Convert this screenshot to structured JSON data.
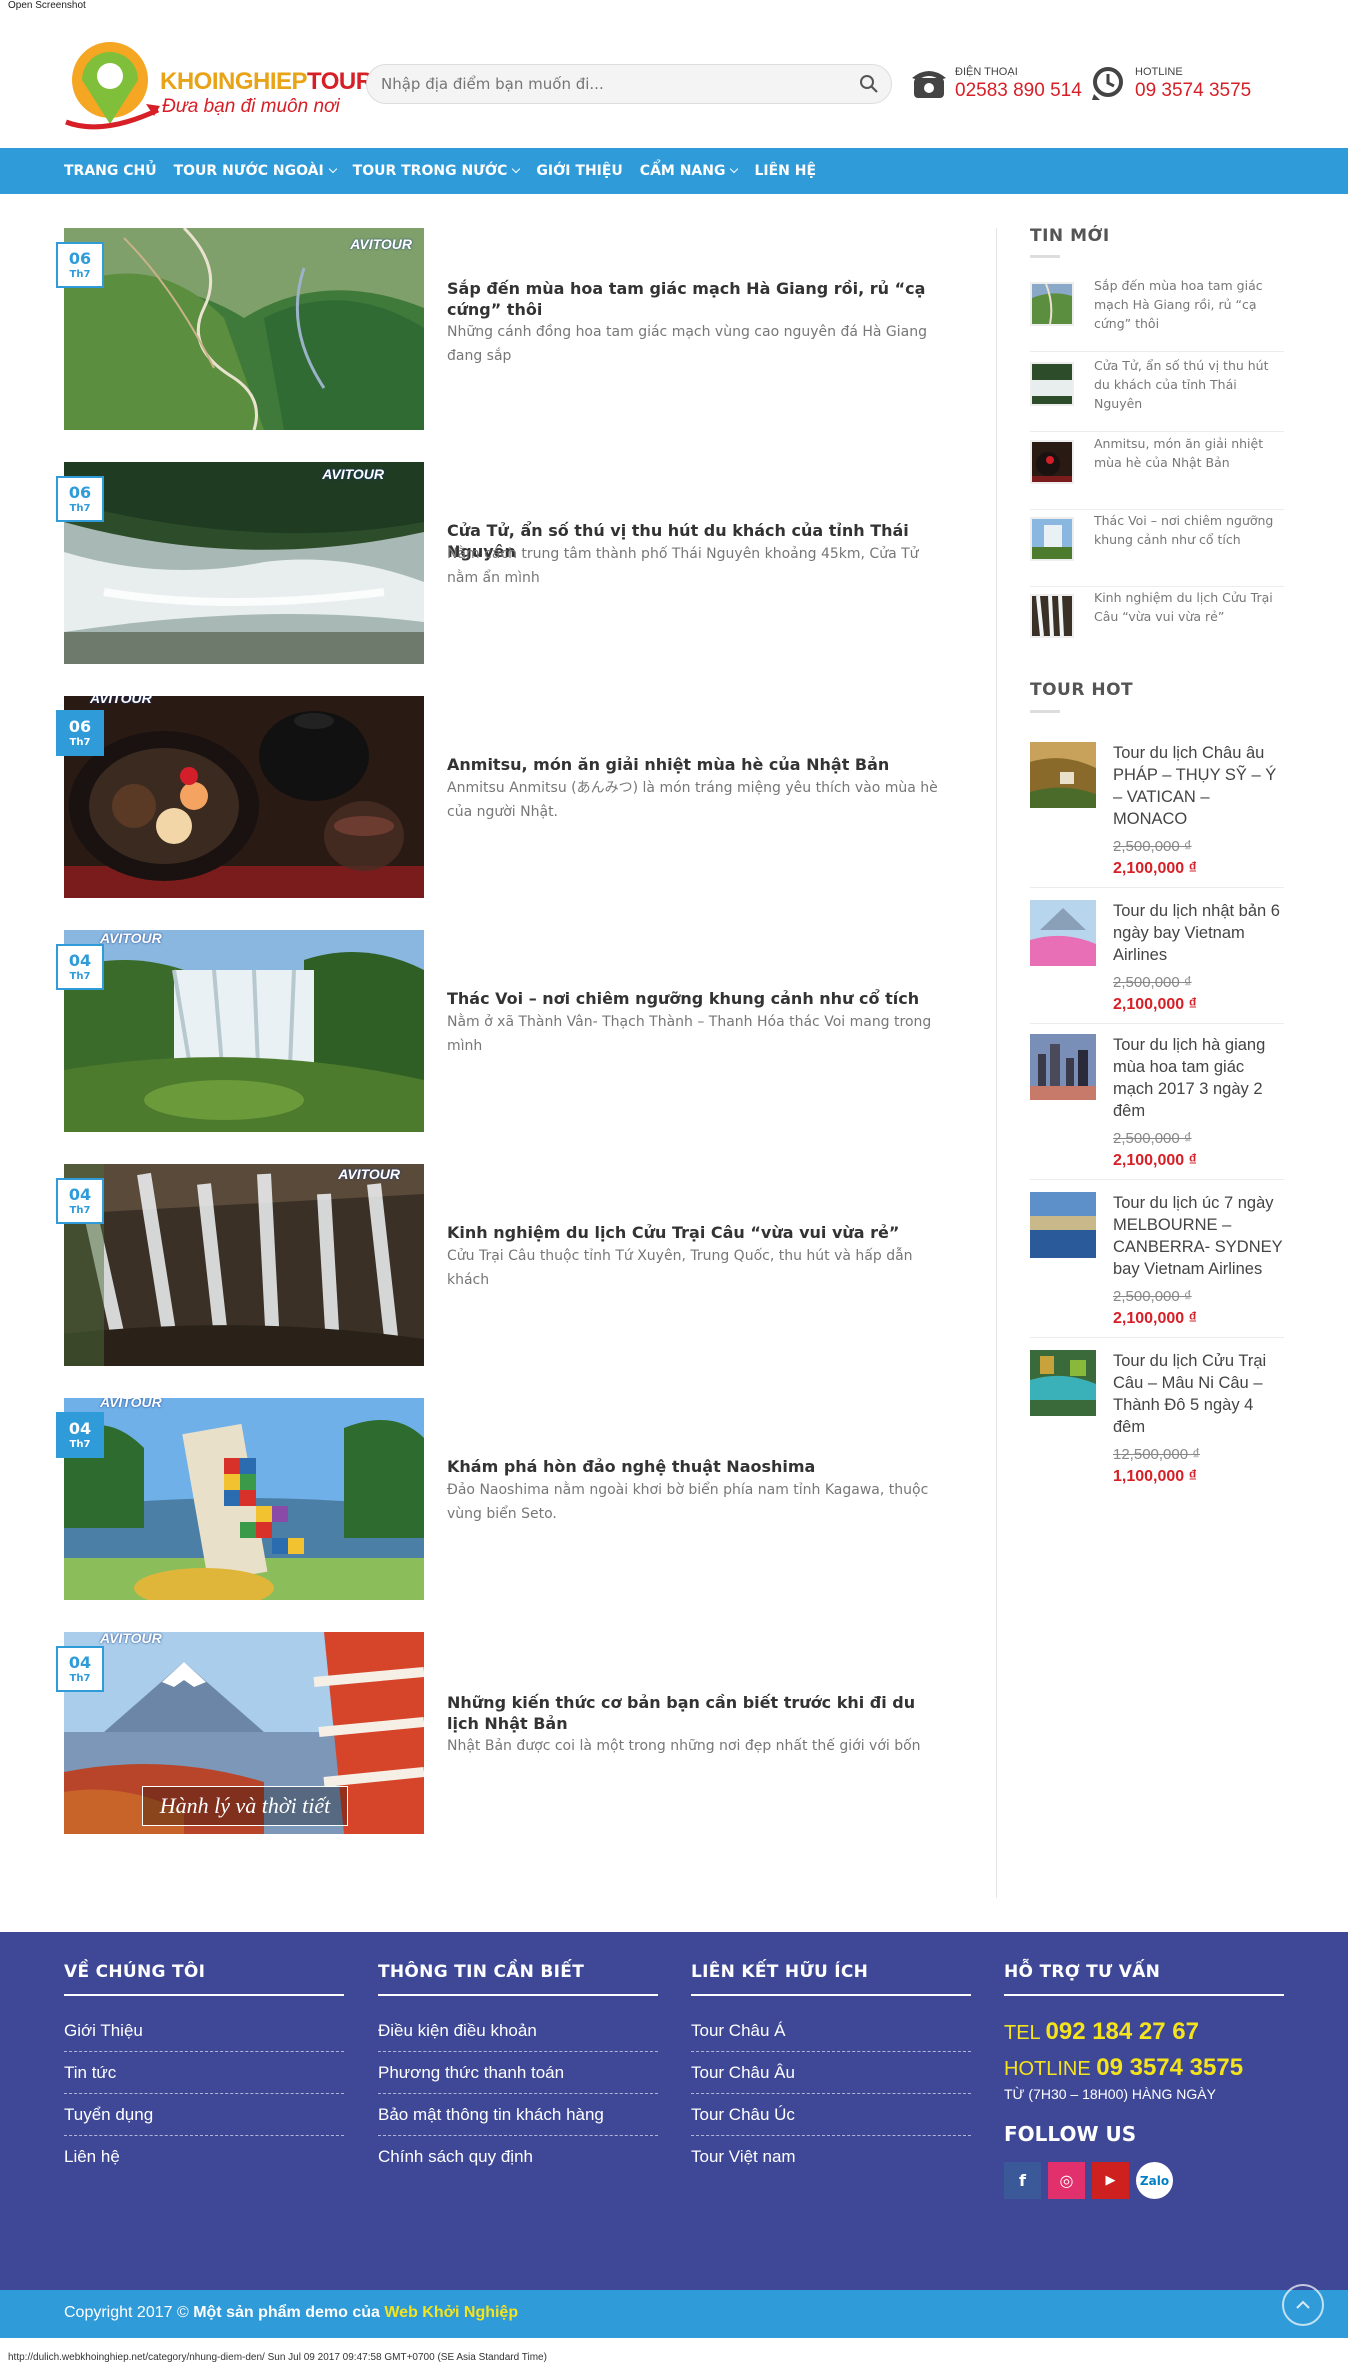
{
  "screenshot_caption": "Open Screenshot",
  "logo": {
    "brand_a": "KHOINGHIEP",
    "brand_b": "TOUR",
    "tagline": "Đưa bạn đi muôn nơi"
  },
  "search": {
    "placeholder": "Nhập địa điểm bạn muốn đi..."
  },
  "contacts": [
    {
      "label": "ĐIỆN THOẠI",
      "number": "02583 890 514",
      "icon": "phone-icon"
    },
    {
      "label": "HOTLINE",
      "number": "09 3574 3575",
      "icon": "hotline-icon"
    }
  ],
  "nav": [
    {
      "label": "TRANG CHỦ",
      "dropdown": false
    },
    {
      "label": "TOUR NƯỚC NGOÀI",
      "dropdown": true
    },
    {
      "label": "TOUR TRONG NƯỚC",
      "dropdown": true
    },
    {
      "label": "GIỚI THIỆU",
      "dropdown": false
    },
    {
      "label": "CẨM NANG",
      "dropdown": true
    },
    {
      "label": "LIÊN HỆ",
      "dropdown": false
    }
  ],
  "posts": [
    {
      "day": "06",
      "month": "Th7",
      "title": "Sắp đến mùa hoa tam giác mạch Hà Giang rồi, rủ “cạ cứng” thôi",
      "excerpt": "Những cánh đồng hoa tam giác mạch vùng cao nguyên đá Hà Giang đang sắp",
      "watermark": "AVITOUR"
    },
    {
      "day": "06",
      "month": "Th7",
      "title": "Cửa Tử, ẩn số thú vị thu hút du khách của tỉnh Thái Nguyên",
      "excerpt": "Nằm cách trung tâm thành phố Thái Nguyên khoảng 45km, Cửa Tử nằm ẩn mình",
      "watermark": "AVITOUR"
    },
    {
      "day": "06",
      "month": "Th7",
      "title": "Anmitsu, món ăn giải nhiệt mùa hè của Nhật Bản",
      "excerpt": "Anmitsu Anmitsu (あんみつ) là món tráng miệng yêu thích vào mùa hè của người Nhật.",
      "watermark": "AVITOUR"
    },
    {
      "day": "04",
      "month": "Th7",
      "title": "Thác Voi – nơi chiêm ngưỡng khung cảnh như cổ tích",
      "excerpt": "Nằm ở xã Thành Vân- Thạch Thành – Thanh Hóa thác Voi mang trong mình",
      "watermark": "AVITOUR"
    },
    {
      "day": "04",
      "month": "Th7",
      "title": "Kinh nghiệm du lịch Cửu Trại Câu “vừa vui vừa rẻ”",
      "excerpt": "Cửu Trại Câu thuộc tỉnh Tứ Xuyên, Trung Quốc, thu hút và hấp dẫn khách",
      "watermark": "AVITOUR"
    },
    {
      "day": "04",
      "month": "Th7",
      "title": "Khám phá hòn đảo nghệ thuật Naoshima",
      "excerpt": "Đảo Naoshima nằm ngoài khơi bờ biển phía nam tỉnh Kagawa, thuộc vùng biển Seto.",
      "watermark": "AVITOUR"
    },
    {
      "day": "04",
      "month": "Th7",
      "title": "Những kiến thức cơ bản bạn cần biết trước khi đi du lịch Nhật Bản",
      "excerpt": "Nhật Bản được coi là một trong những nơi đẹp nhất thế giới với bốn",
      "watermark": "AVITOUR",
      "caption": "Hành lý và thời tiết"
    }
  ],
  "sidebar": {
    "news_heading": "TIN MỚI",
    "news": [
      "Sắp đến mùa hoa tam giác mạch Hà Giang rồi, rủ “cạ cứng” thôi",
      "Cửa Tử, ẩn số thú vị thu hút du khách của tỉnh Thái Nguyên",
      "Anmitsu, món ăn giải nhiệt mùa hè của Nhật Bản",
      "Thác Voi – nơi chiêm ngưỡng khung cảnh như cổ tích",
      "Kinh nghiệm du lịch Cửu Trại Câu “vừa vui vừa rẻ”"
    ],
    "hot_heading": "TOUR HOT",
    "hot": [
      {
        "title": "Tour du lịch Châu âu PHÁP – THỤY SỸ – Ý – VATICAN – MONACO",
        "old_price": "2,500,000 ₫",
        "price": "2,100,000 ₫"
      },
      {
        "title": "Tour du lịch nhật bản 6 ngày bay Vietnam Airlines",
        "old_price": "2,500,000 ₫",
        "price": "2,100,000 ₫"
      },
      {
        "title": "Tour du lịch hà giang mùa hoa tam giác mạch 2017 3 ngày 2 đêm",
        "old_price": "2,500,000 ₫",
        "price": "2,100,000 ₫"
      },
      {
        "title": "Tour du lịch úc 7 ngày MELBOURNE – CANBERRA- SYDNEY bay Vietnam Airlines",
        "old_price": "2,500,000 ₫",
        "price": "2,100,000 ₫"
      },
      {
        "title": "Tour du lịch Cửu Trại Câu – Mâu Ni Câu – Thành Đô 5 ngày 4 đêm",
        "old_price": "12,500,000 ₫",
        "price": "1,100,000 ₫"
      }
    ]
  },
  "footer": {
    "col1": {
      "heading": "VỀ CHÚNG TÔI",
      "links": [
        "Giới Thiệu",
        "Tin tức",
        "Tuyển dụng",
        "Liên hệ"
      ]
    },
    "col2": {
      "heading": "THÔNG TIN CẦN BIẾT",
      "links": [
        "Điều kiện điều khoản",
        "Phương thức thanh toán",
        "Bảo mật thông tin khách hàng",
        "Chính sách quy định"
      ]
    },
    "col3": {
      "heading": "LIÊN KẾT HỮU ÍCH",
      "links": [
        "Tour Châu Á",
        "Tour Châu Âu",
        "Tour Châu Úc",
        "Tour Việt nam"
      ]
    },
    "col4": {
      "heading": "HỖ TRỢ TƯ VẤN",
      "tel_label": "TEL",
      "tel": "092 184 27 67",
      "hotline_label": "HOTLINE",
      "hotline": "09 3574 3575",
      "hours": "TỪ (7H30 – 18H00) HÀNG NGÀY",
      "follow": "FOLLOW US",
      "social": [
        {
          "icon": "facebook-icon",
          "glyph": "f",
          "color": "#3b5998"
        },
        {
          "icon": "instagram-icon",
          "glyph": "◎",
          "color": "#e1306c"
        },
        {
          "icon": "youtube-icon",
          "glyph": "▶",
          "color": "#cd201f"
        },
        {
          "icon": "zalo-icon",
          "glyph": "Zalo",
          "color": "#0180c7"
        }
      ]
    },
    "copyright_prefix": "Copyright 2017 ©",
    "copyright_middle": "Một sản phẩm demo của",
    "copyright_link": "Web Khởi Nghiệp"
  },
  "status_bar": "http://dulich.webkhoinghiep.net/category/nhung-diem-den/ Sun Jul 09 2017 09:47:58 GMT+0700 (SE Asia Standard Time)",
  "colors": {
    "nav": "#2f9bd9",
    "footer": "#3e4897",
    "price": "#d61f26",
    "highlight": "#f5e41c"
  }
}
